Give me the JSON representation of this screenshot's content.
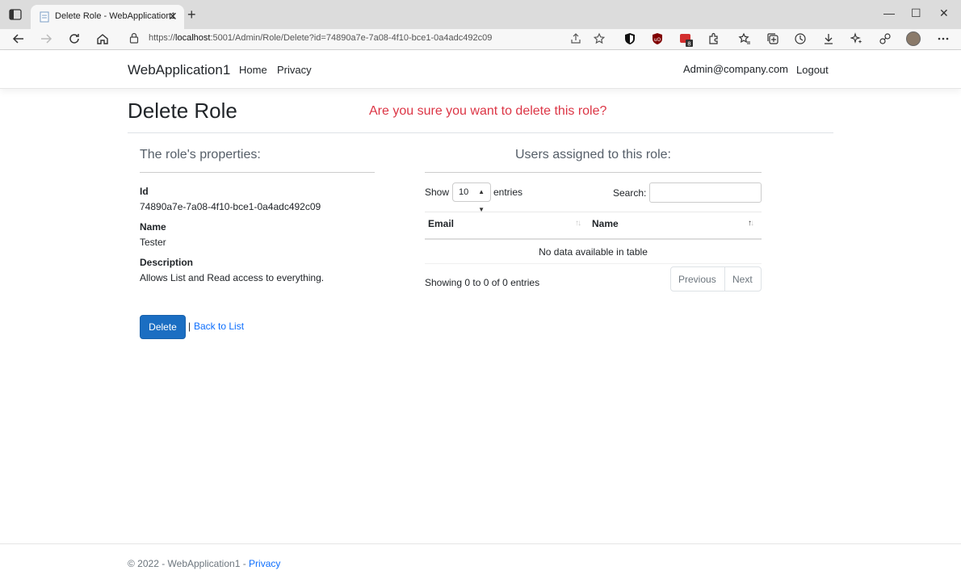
{
  "browser": {
    "tab_title": "Delete Role - WebApplication1",
    "tab_close": "✕",
    "new_tab": "+",
    "url_prefix": "https://",
    "url_host": "localhost",
    "url_rest": ":5001/Admin/Role/Delete?id=74890a7e-7a08-4f10-bce1-0a4adc492c09",
    "ext_badge": "8",
    "window_controls": {
      "minimize": "—",
      "maximize": "☐",
      "close": "✕"
    }
  },
  "navbar": {
    "brand": "WebApplication1",
    "links": {
      "home": "Home",
      "privacy": "Privacy"
    },
    "user": "Admin@company.com",
    "logout": "Logout"
  },
  "page": {
    "title": "Delete Role",
    "confirm_message": "Are you sure you want to delete this role?"
  },
  "properties": {
    "heading": "The role's properties:",
    "id_label": "Id",
    "id_value": "74890a7e-7a08-4f10-bce1-0a4adc492c09",
    "name_label": "Name",
    "name_value": "Tester",
    "description_label": "Description",
    "description_value": "Allows List and Read access to everything."
  },
  "actions": {
    "delete_label": "Delete",
    "separator": "|",
    "back_label": "Back to List"
  },
  "users_table": {
    "heading": "Users assigned to this role:",
    "show_label": "Show",
    "page_length": "10",
    "entries_label": "entries",
    "search_label": "Search:",
    "search_value": "",
    "columns": [
      "Email",
      "Name"
    ],
    "empty_message": "No data available in table",
    "info": "Showing 0 to 0 of 0 entries",
    "previous_label": "Previous",
    "next_label": "Next"
  },
  "footer": {
    "text": "© 2022 - WebApplication1 - ",
    "privacy_link": "Privacy"
  },
  "colors": {
    "primary": "#1b6ec2",
    "danger": "#dc3545",
    "link": "#0d6efd"
  }
}
